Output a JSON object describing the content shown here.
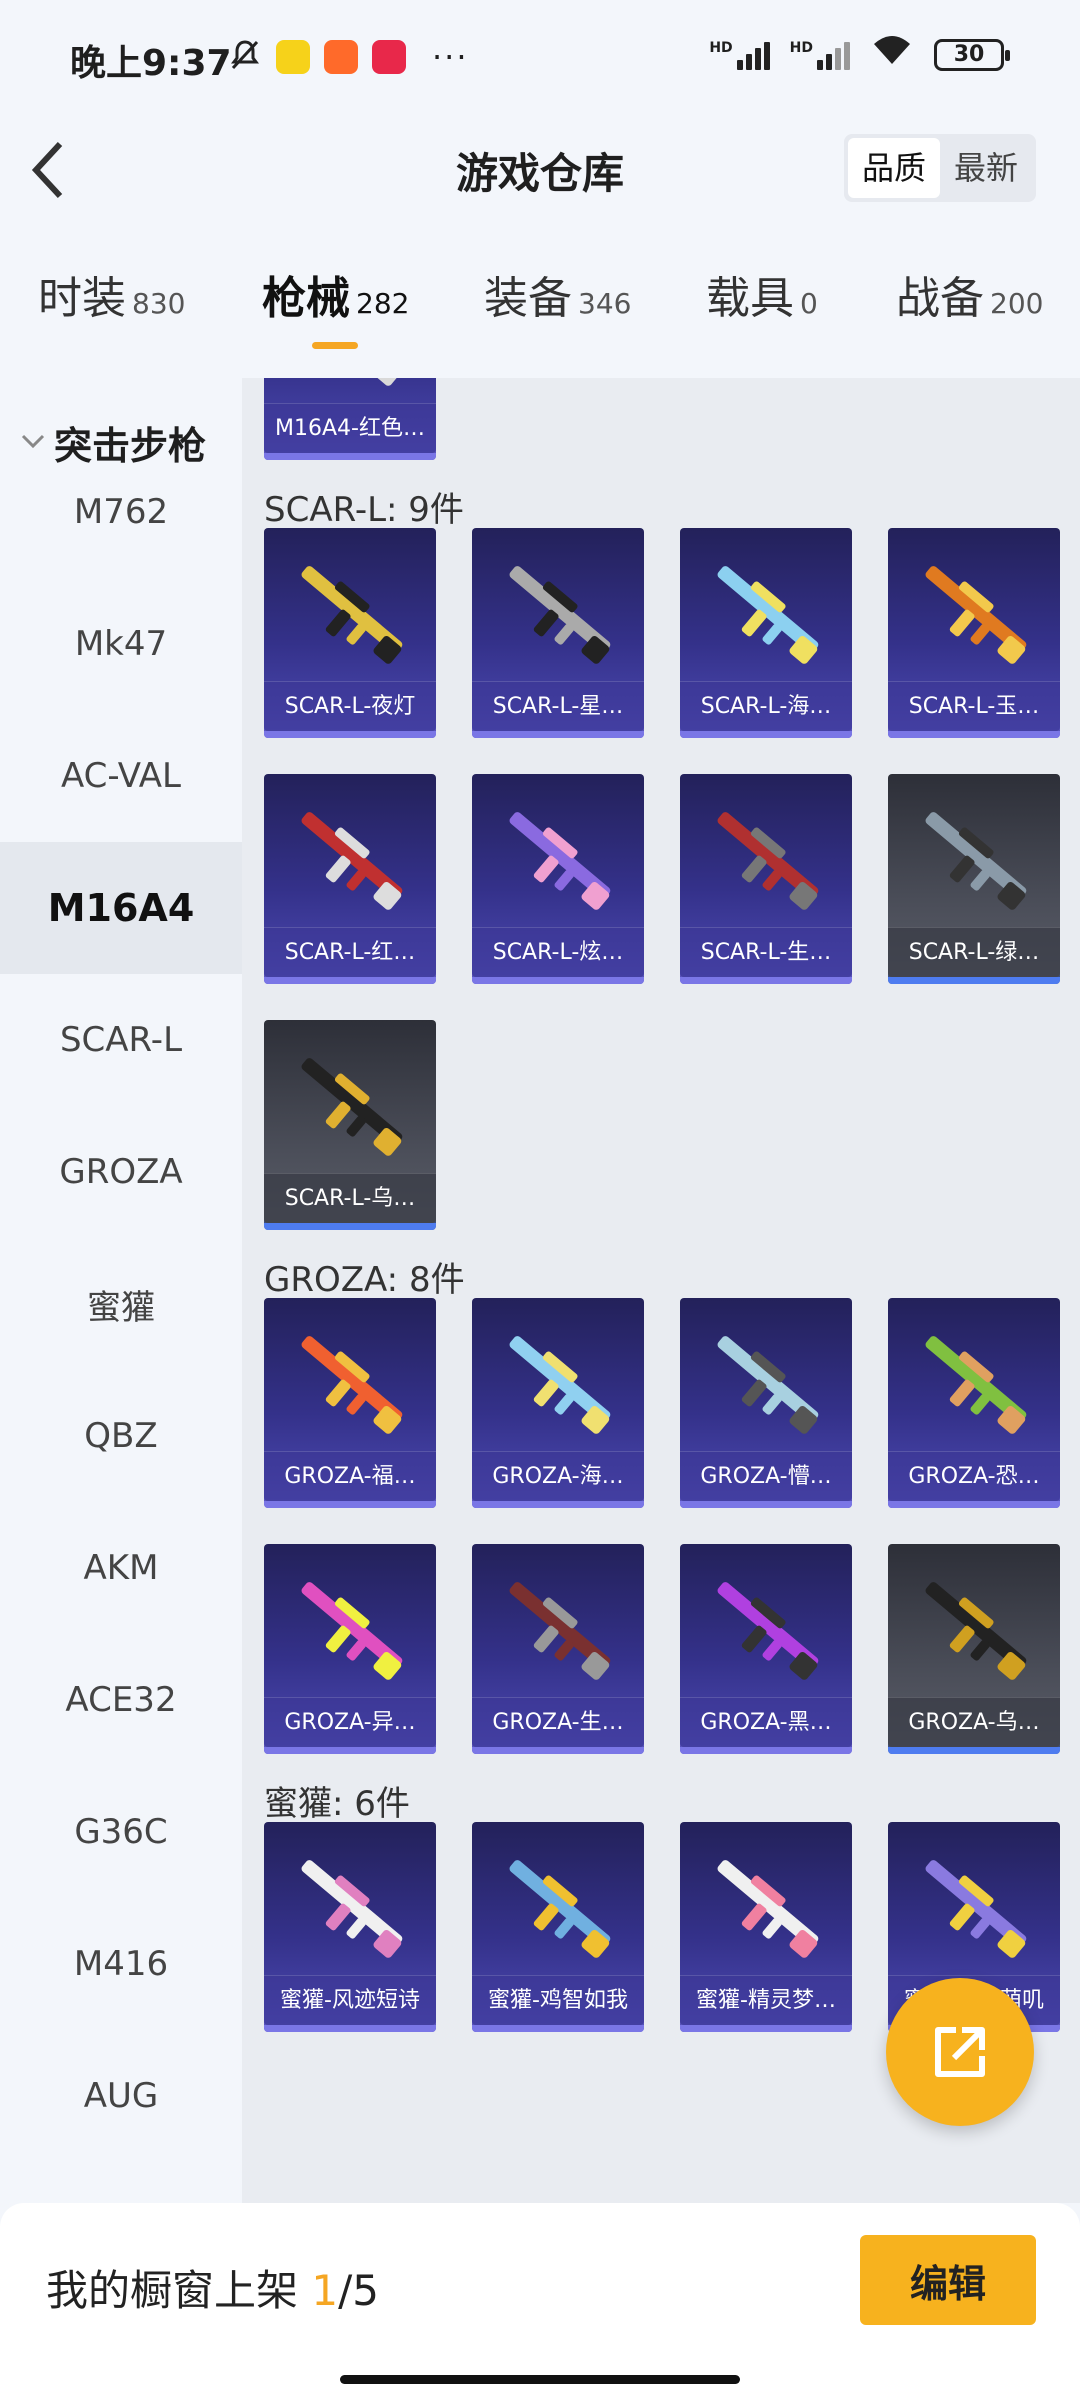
{
  "status_bar": {
    "time": "晚上9:37",
    "network_labels": [
      "HD",
      "HD"
    ],
    "battery": "30",
    "more": "···"
  },
  "header": {
    "title": "游戏仓库",
    "back_icon": "chevron-left-icon",
    "sort_options": [
      "品质",
      "最新"
    ],
    "sort_selected": "品质"
  },
  "category_tabs": [
    {
      "label": "时装",
      "count": "830"
    },
    {
      "label": "枪械",
      "count": "282",
      "active": true
    },
    {
      "label": "装备",
      "count": "346"
    },
    {
      "label": "载具",
      "count": "0"
    },
    {
      "label": "战备",
      "count": "200"
    }
  ],
  "sidebar": {
    "group_title": "突击步枪",
    "items": [
      "M762",
      "Mk47",
      "AC-VAL",
      "M16A4",
      "SCAR-L",
      "GROZA",
      "蜜獾",
      "QBZ",
      "AKM",
      "ACE32",
      "G36C",
      "M416",
      "AUG"
    ],
    "active_item": "M16A4"
  },
  "sections": [
    {
      "title": "",
      "items": [
        {
          "name": "M16A4-红色…",
          "style": "purple"
        }
      ]
    },
    {
      "title": "SCAR-L: 9件",
      "items": [
        {
          "name": "SCAR-L-夜灯",
          "style": "purple"
        },
        {
          "name": "SCAR-L-星…",
          "style": "purple"
        },
        {
          "name": "SCAR-L-海…",
          "style": "purple"
        },
        {
          "name": "SCAR-L-玉…",
          "style": "purple"
        },
        {
          "name": "SCAR-L-红…",
          "style": "purple"
        },
        {
          "name": "SCAR-L-炫…",
          "style": "purple"
        },
        {
          "name": "SCAR-L-生…",
          "style": "purple"
        },
        {
          "name": "SCAR-L-绿…",
          "style": "grey"
        },
        {
          "name": "SCAR-L-乌…",
          "style": "grey"
        }
      ]
    },
    {
      "title": "GROZA: 8件",
      "items": [
        {
          "name": "GROZA-福…",
          "style": "purple"
        },
        {
          "name": "GROZA-海…",
          "style": "purple"
        },
        {
          "name": "GROZA-懵…",
          "style": "purple"
        },
        {
          "name": "GROZA-恐…",
          "style": "purple"
        },
        {
          "name": "GROZA-异…",
          "style": "purple"
        },
        {
          "name": "GROZA-生…",
          "style": "purple"
        },
        {
          "name": "GROZA-黑…",
          "style": "purple"
        },
        {
          "name": "GROZA-乌…",
          "style": "grey"
        }
      ]
    },
    {
      "title": "蜜獾: 6件",
      "items": [
        {
          "name": "蜜獾-风迹短诗",
          "style": "purple"
        },
        {
          "name": "蜜獾-鸡智如我",
          "style": "purple"
        },
        {
          "name": "蜜獾-精灵梦…",
          "style": "purple"
        },
        {
          "name": "蜜獾-天降萌叽",
          "style": "purple"
        }
      ]
    }
  ],
  "bottom_bar": {
    "label": "我的橱窗上架",
    "current": "1",
    "total": "/5",
    "edit_label": "编辑"
  },
  "fab": {
    "icon": "share-external-icon"
  },
  "colors": {
    "accent": "#f7b21e",
    "card_purple": "#34318a",
    "card_grey": "#4a4d58",
    "page_bg": "#f3f6fb"
  }
}
